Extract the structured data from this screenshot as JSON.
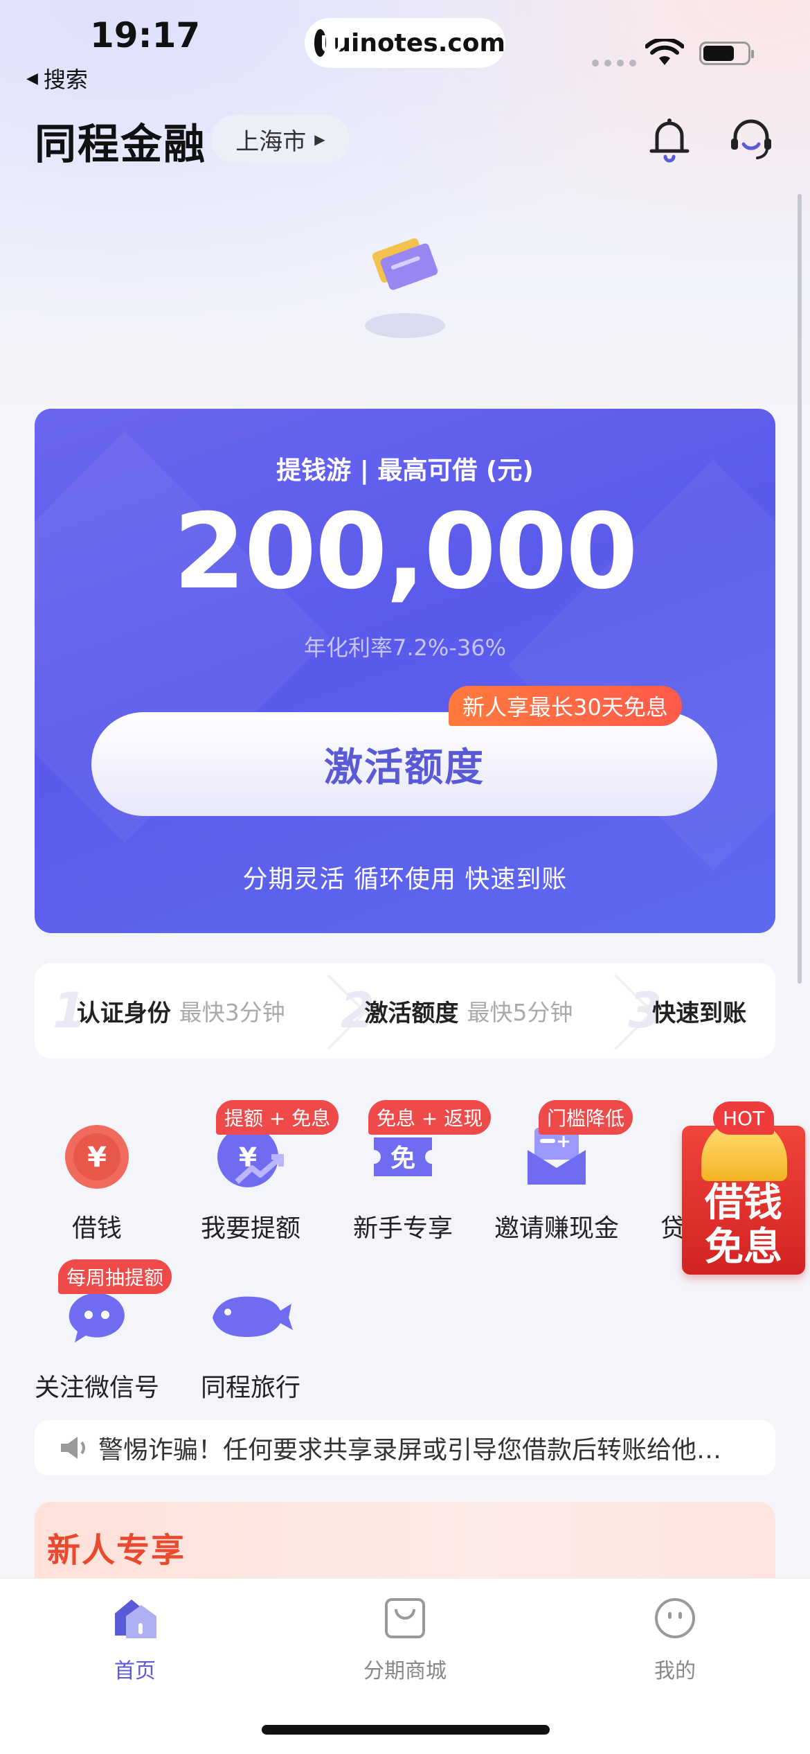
{
  "status": {
    "time": "19:17",
    "back_label": "搜索",
    "url": "uinotes.com"
  },
  "header": {
    "title": "同程金融",
    "city": "上海市"
  },
  "card": {
    "subtitle": "提钱游 | 最高可借 (元)",
    "amount": "200,000",
    "rate": "年化利率7.2%-36%",
    "promo": "新人享最长30天免息",
    "button": "激活额度",
    "footer": "分期灵活 循环使用 快速到账"
  },
  "steps": [
    {
      "num": "1",
      "name": "认证身份",
      "hint": "最快3分钟"
    },
    {
      "num": "2",
      "name": "激活额度",
      "hint": "最快5分钟"
    },
    {
      "num": "3",
      "name": "快速到账"
    }
  ],
  "grid": [
    {
      "label": "借钱",
      "icon": "yuan-coin-icon"
    },
    {
      "label": "我要提额",
      "badge": "提额 + 免息",
      "icon": "raise-limit-icon"
    },
    {
      "label": "新手专享",
      "badge": "免息 + 返现",
      "icon": "coupon-icon"
    },
    {
      "label": "邀请赚现金",
      "badge": "门槛降低",
      "icon": "invite-envelope-icon"
    },
    {
      "label": "贷",
      "icon": "loan-icon"
    },
    {
      "label": "关注微信号",
      "badge": "每周抽提额",
      "icon": "wechat-bubble-icon"
    },
    {
      "label": "同程旅行",
      "icon": "whale-icon"
    }
  ],
  "float_ad": {
    "hot": "HOT",
    "text_line1": "借钱",
    "text_line2": "免息"
  },
  "notice": {
    "text": "警惕诈骗！任何要求共享录屏或引导您借款后转账给他…"
  },
  "newbie": {
    "title": "新人专享"
  },
  "tabs": [
    {
      "label": "首页",
      "active": true
    },
    {
      "label": "分期商城"
    },
    {
      "label": "我的"
    }
  ],
  "colors": {
    "primary": "#5b5ad6",
    "card_bg": "#6262ee",
    "badge_red": "#ef4a4a",
    "promo_orange": "#ff6a40"
  }
}
